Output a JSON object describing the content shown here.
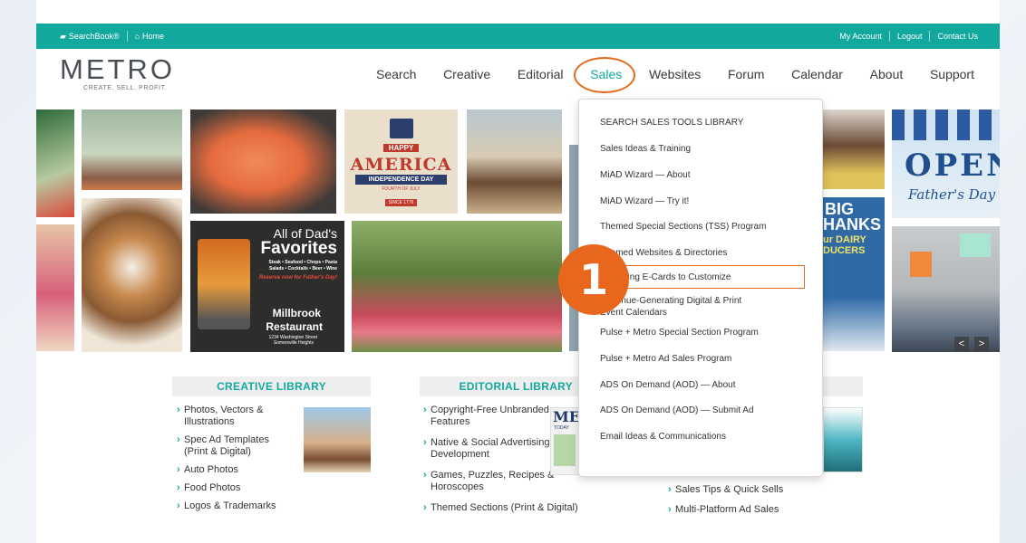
{
  "topbar": {
    "searchbook": "SearchBook®",
    "home": "Home",
    "my_account": "My Account",
    "logout": "Logout",
    "contact": "Contact Us"
  },
  "logo": {
    "word": "METRO",
    "tagline": "CREATE. SELL. PROFIT."
  },
  "nav": [
    "Search",
    "Creative",
    "Editorial",
    "Sales",
    "Websites",
    "Forum",
    "Calendar",
    "About",
    "Support"
  ],
  "tiles": {
    "happy": "HAPPY",
    "america": "AMERICA",
    "independence": "INDEPENDENCE DAY",
    "fourth": "FOURTH OF JULY",
    "since": "SINCE 1776",
    "dads_1": "All of Dad's",
    "dads_2": "Favorites",
    "dads_3": "Steak • Seafood • Chops • Pasta",
    "dads_4": "Salads • Cocktails • Beer • Wine",
    "dads_5": "Reserve now for Father's Day!",
    "millbrook_1": "Millbrook",
    "millbrook_2": "Restaurant",
    "millbrook_3": "1234 Washington Street",
    "millbrook_4": "Somersville Heights",
    "open": "OPEN",
    "fathers_day": "Father's Day",
    "big": "BIG",
    "thanks": "HANKS",
    "dairy": "ur DAIRY",
    "producers": "DUCERS"
  },
  "dropdown": [
    "SEARCH SALES TOOLS LIBRARY",
    "Sales Ideas & Training",
    "MiAD Wizard — About",
    "MiAD Wizard — Try it!",
    "Themed Special Sections (TSS) Program",
    "Themed Websites & Directories",
    "Marketing E-Cards to Customize",
    "Revenue-Generating Digital & Print Event Calendars",
    "Pulse + Metro Special Section Program",
    "Pulse + Metro Ad Sales Program",
    "ADS On Demand (AOD) — About",
    "ADS On Demand (AOD) — Submit Ad",
    "Email Ideas & Communications"
  ],
  "badge": "1",
  "creative": {
    "title": "CREATIVE LIBRARY",
    "items": [
      "Photos, Vectors & Illustrations",
      "Spec Ad Templates (Print & Digital)",
      "Auto Photos",
      "Food Photos",
      "Logos & Trademarks"
    ]
  },
  "editorial": {
    "title": "EDITORIAL LIBRARY",
    "items": [
      "Copyright-Free Unbranded Features",
      "Native & Social Advertising Development",
      "Games, Puzzles, Recipes & Horoscopes",
      "Themed Sections (Print & Digital)"
    ],
    "mag_title": "ME",
    "mag_sub": "TODAY"
  },
  "sales": {
    "items": [
      "Sales Tips & Quick Sells",
      "Multi-Platform Ad Sales"
    ]
  },
  "carousel": {
    "prev": "<",
    "next": ">"
  },
  "colors": {
    "teal": "#13a89e",
    "orange": "#e8671c"
  }
}
